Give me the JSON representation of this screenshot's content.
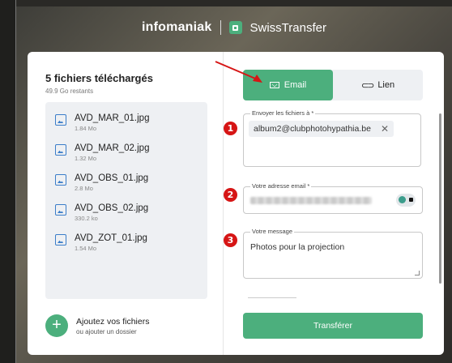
{
  "header": {
    "brand": "infomaniak",
    "product": "SwissTransfer"
  },
  "files": {
    "title": "5 fichiers téléchargés",
    "remaining": "49.9 Go restants",
    "items": [
      {
        "name": "AVD_MAR_01.jpg",
        "size": "1.84 Mo"
      },
      {
        "name": "AVD_MAR_02.jpg",
        "size": "1.32 Mo"
      },
      {
        "name": "AVD_OBS_01.jpg",
        "size": "2.8 Mo"
      },
      {
        "name": "AVD_OBS_02.jpg",
        "size": "330.2 ko"
      },
      {
        "name": "AVD_ZOT_01.jpg",
        "size": "1.54 Mo"
      }
    ],
    "add_label": "Ajoutez vos fichiers",
    "add_folder": "ou ajouter un dossier"
  },
  "tabs": {
    "email": "Email",
    "link": "Lien"
  },
  "form": {
    "recipients_label": "Envoyer les fichiers à *",
    "recipient_chip": "album2@clubphotohypathia.be",
    "sender_label": "Votre adresse email *",
    "message_label": "Votre message",
    "message_value": "Photos pour la projection",
    "submit": "Transférer"
  },
  "annotations": {
    "step1": "1",
    "step2": "2",
    "step3": "3"
  },
  "colors": {
    "accent": "#4caf7d",
    "annotation": "#d61515"
  }
}
